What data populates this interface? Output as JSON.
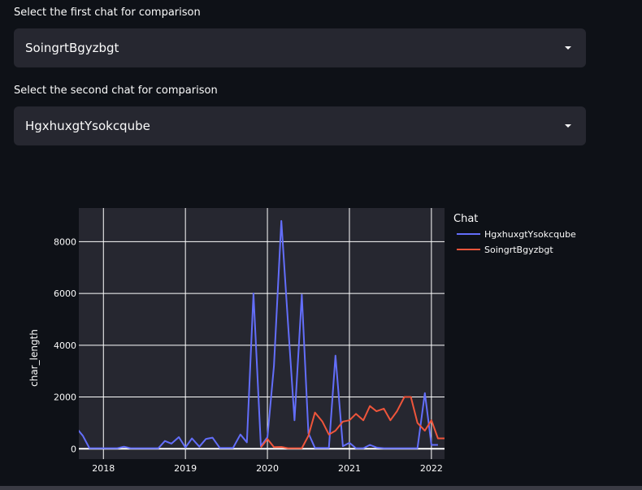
{
  "selectors": {
    "first": {
      "label": "Select the first chat for comparison",
      "value": "SoingrtBgyzbgt"
    },
    "second": {
      "label": "Select the second chat for comparison",
      "value": "HgxhuxgtYsokcqube"
    }
  },
  "chart_data": {
    "type": "line",
    "ylabel": "char_length",
    "xlabel": "",
    "legend_title": "Chat",
    "legend_position": "top-right",
    "grid": true,
    "xlim": [
      2017.7,
      2022.16
    ],
    "ylim": [
      -400,
      9300
    ],
    "xticks": [
      2018,
      2019,
      2020,
      2021,
      2022
    ],
    "xtick_labels": [
      "2018",
      "2019",
      "2020",
      "2021",
      "2022"
    ],
    "yticks": [
      0,
      2000,
      4000,
      6000,
      8000
    ],
    "ytick_labels": [
      "0",
      "2000",
      "4000",
      "6000",
      "8000"
    ],
    "background": "#262730",
    "series": [
      {
        "name": "HgxhuxgtYsokcqube",
        "color": "#636efa",
        "x": [
          2017.67,
          2017.75,
          2017.83,
          2017.92,
          2018.0,
          2018.08,
          2018.17,
          2018.25,
          2018.33,
          2018.42,
          2018.5,
          2018.58,
          2018.67,
          2018.75,
          2018.83,
          2018.92,
          2019.0,
          2019.08,
          2019.17,
          2019.25,
          2019.33,
          2019.42,
          2019.5,
          2019.58,
          2019.67,
          2019.75,
          2019.83,
          2019.92,
          2020.0,
          2020.08,
          2020.17,
          2020.25,
          2020.33,
          2020.42,
          2020.5,
          2020.58,
          2020.67,
          2020.75,
          2020.83,
          2020.92,
          2021.0,
          2021.08,
          2021.17,
          2021.25,
          2021.33,
          2021.42,
          2021.5,
          2021.58,
          2021.67,
          2021.75,
          2021.83,
          2021.92,
          2022.0,
          2022.08
        ],
        "values": [
          800,
          500,
          20,
          20,
          20,
          20,
          20,
          80,
          20,
          20,
          20,
          20,
          20,
          300,
          200,
          450,
          50,
          400,
          80,
          380,
          430,
          30,
          30,
          30,
          550,
          250,
          6000,
          100,
          450,
          3200,
          8800,
          4900,
          1100,
          5950,
          600,
          30,
          30,
          30,
          3600,
          100,
          230,
          20,
          20,
          150,
          50,
          20,
          20,
          20,
          20,
          20,
          20,
          2150,
          150,
          150
        ]
      },
      {
        "name": "SoingrtBgyzbgt",
        "color": "#ef553b",
        "x": [
          2019.92,
          2020.0,
          2020.08,
          2020.17,
          2020.25,
          2020.33,
          2020.42,
          2020.5,
          2020.58,
          2020.67,
          2020.75,
          2020.83,
          2020.92,
          2021.0,
          2021.08,
          2021.17,
          2021.25,
          2021.33,
          2021.42,
          2021.5,
          2021.58,
          2021.67,
          2021.75,
          2021.83,
          2021.92,
          2022.0,
          2022.08,
          2022.16
        ],
        "values": [
          50,
          380,
          60,
          70,
          20,
          20,
          20,
          500,
          1400,
          1050,
          550,
          700,
          1050,
          1100,
          1350,
          1100,
          1650,
          1450,
          1550,
          1100,
          1450,
          2000,
          2000,
          1000,
          700,
          1100,
          400,
          400
        ]
      }
    ]
  }
}
